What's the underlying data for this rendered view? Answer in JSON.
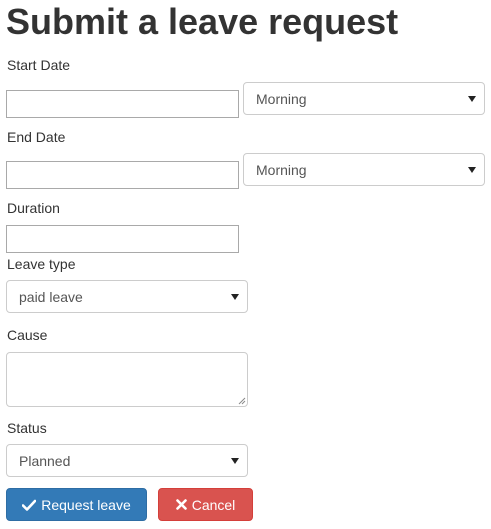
{
  "page": {
    "title": "Submit a leave request"
  },
  "form": {
    "start_date": {
      "label": "Start Date",
      "value": "",
      "period": "Morning"
    },
    "end_date": {
      "label": "End Date",
      "value": "",
      "period": "Morning"
    },
    "duration": {
      "label": "Duration",
      "value": ""
    },
    "leave_type": {
      "label": "Leave type",
      "selected": "paid leave"
    },
    "cause": {
      "label": "Cause",
      "value": ""
    },
    "status": {
      "label": "Status",
      "selected": "Planned"
    }
  },
  "actions": {
    "request_label": "Request leave",
    "request_icon": "check-icon",
    "cancel_label": "Cancel",
    "cancel_icon": "times-icon"
  },
  "colors": {
    "primary": "#337ab7",
    "danger": "#d9534f",
    "text": "#333333"
  }
}
